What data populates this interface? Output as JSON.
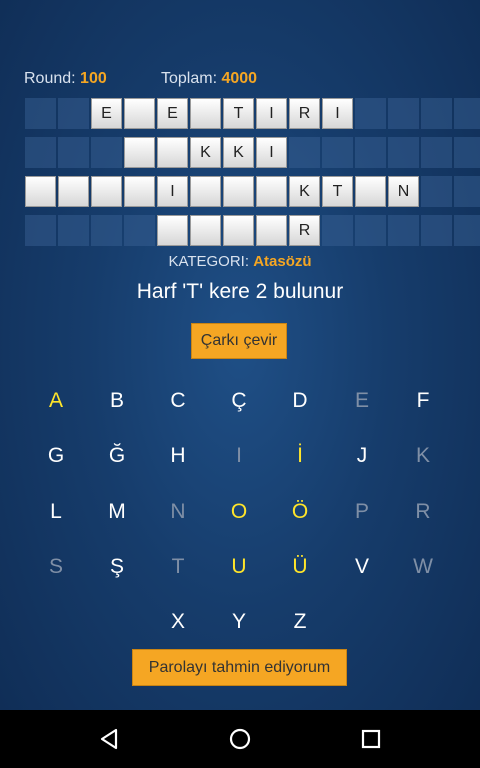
{
  "stats": {
    "round_label": "Round:",
    "round_value": "100",
    "total_label": "Toplam:",
    "total_value": "4000"
  },
  "board": {
    "rows": [
      [
        "",
        "",
        "E",
        "",
        "E",
        "",
        "T",
        "I",
        "R",
        "I",
        "",
        "",
        "",
        ""
      ],
      [
        "",
        "",
        "",
        "",
        "",
        "K",
        "K",
        "I",
        "",
        "",
        "",
        "",
        "",
        ""
      ],
      [
        "",
        "",
        "",
        "",
        "I",
        "",
        "",
        "",
        "K",
        "T",
        "",
        "N",
        "",
        ""
      ],
      [
        "",
        "",
        "",
        "",
        "",
        "",
        "",
        "",
        "R",
        "",
        "",
        "",
        "",
        ""
      ]
    ],
    "tile_mask": [
      [
        0,
        0,
        1,
        1,
        1,
        1,
        1,
        1,
        1,
        1,
        0,
        0,
        0,
        0
      ],
      [
        0,
        0,
        0,
        1,
        1,
        1,
        1,
        1,
        0,
        0,
        0,
        0,
        0,
        0
      ],
      [
        1,
        1,
        1,
        1,
        1,
        1,
        1,
        1,
        1,
        1,
        1,
        1,
        0,
        0
      ],
      [
        0,
        0,
        0,
        0,
        1,
        1,
        1,
        1,
        1,
        0,
        0,
        0,
        0,
        0
      ]
    ]
  },
  "category": {
    "label": "KATEGORI:",
    "value": "Atasözü"
  },
  "hint": "Harf 'T' kere 2 bulunur",
  "spin_button": "Çarkı çevir",
  "guess_button": "Parolayı tahmin ediyorum",
  "keyboard": {
    "rows": [
      [
        "A",
        "B",
        "C",
        "Ç",
        "D",
        "E",
        "F"
      ],
      [
        "G",
        "Ğ",
        "H",
        "I",
        "İ",
        "J",
        "K"
      ],
      [
        "L",
        "M",
        "N",
        "O",
        "Ö",
        "P",
        "R"
      ],
      [
        "S",
        "Ş",
        "T",
        "U",
        "Ü",
        "V",
        "W"
      ],
      [
        "X",
        "Y",
        "Z"
      ]
    ],
    "states": [
      [
        "vowel",
        "active",
        "active",
        "active",
        "active",
        "used",
        "active"
      ],
      [
        "active",
        "active",
        "active",
        "used",
        "vowel",
        "active",
        "used"
      ],
      [
        "active",
        "active",
        "used",
        "vowel",
        "vowel",
        "used",
        "used"
      ],
      [
        "used",
        "active",
        "used",
        "vowel",
        "vowel",
        "active",
        "used"
      ],
      [
        "active",
        "active",
        "active"
      ]
    ]
  },
  "colors": {
    "accent": "#f5a623",
    "vowel": "#ffe52a",
    "used": "#7f8fa6"
  },
  "navbar": {
    "icons": [
      "back-icon",
      "home-icon",
      "recents-icon"
    ]
  }
}
